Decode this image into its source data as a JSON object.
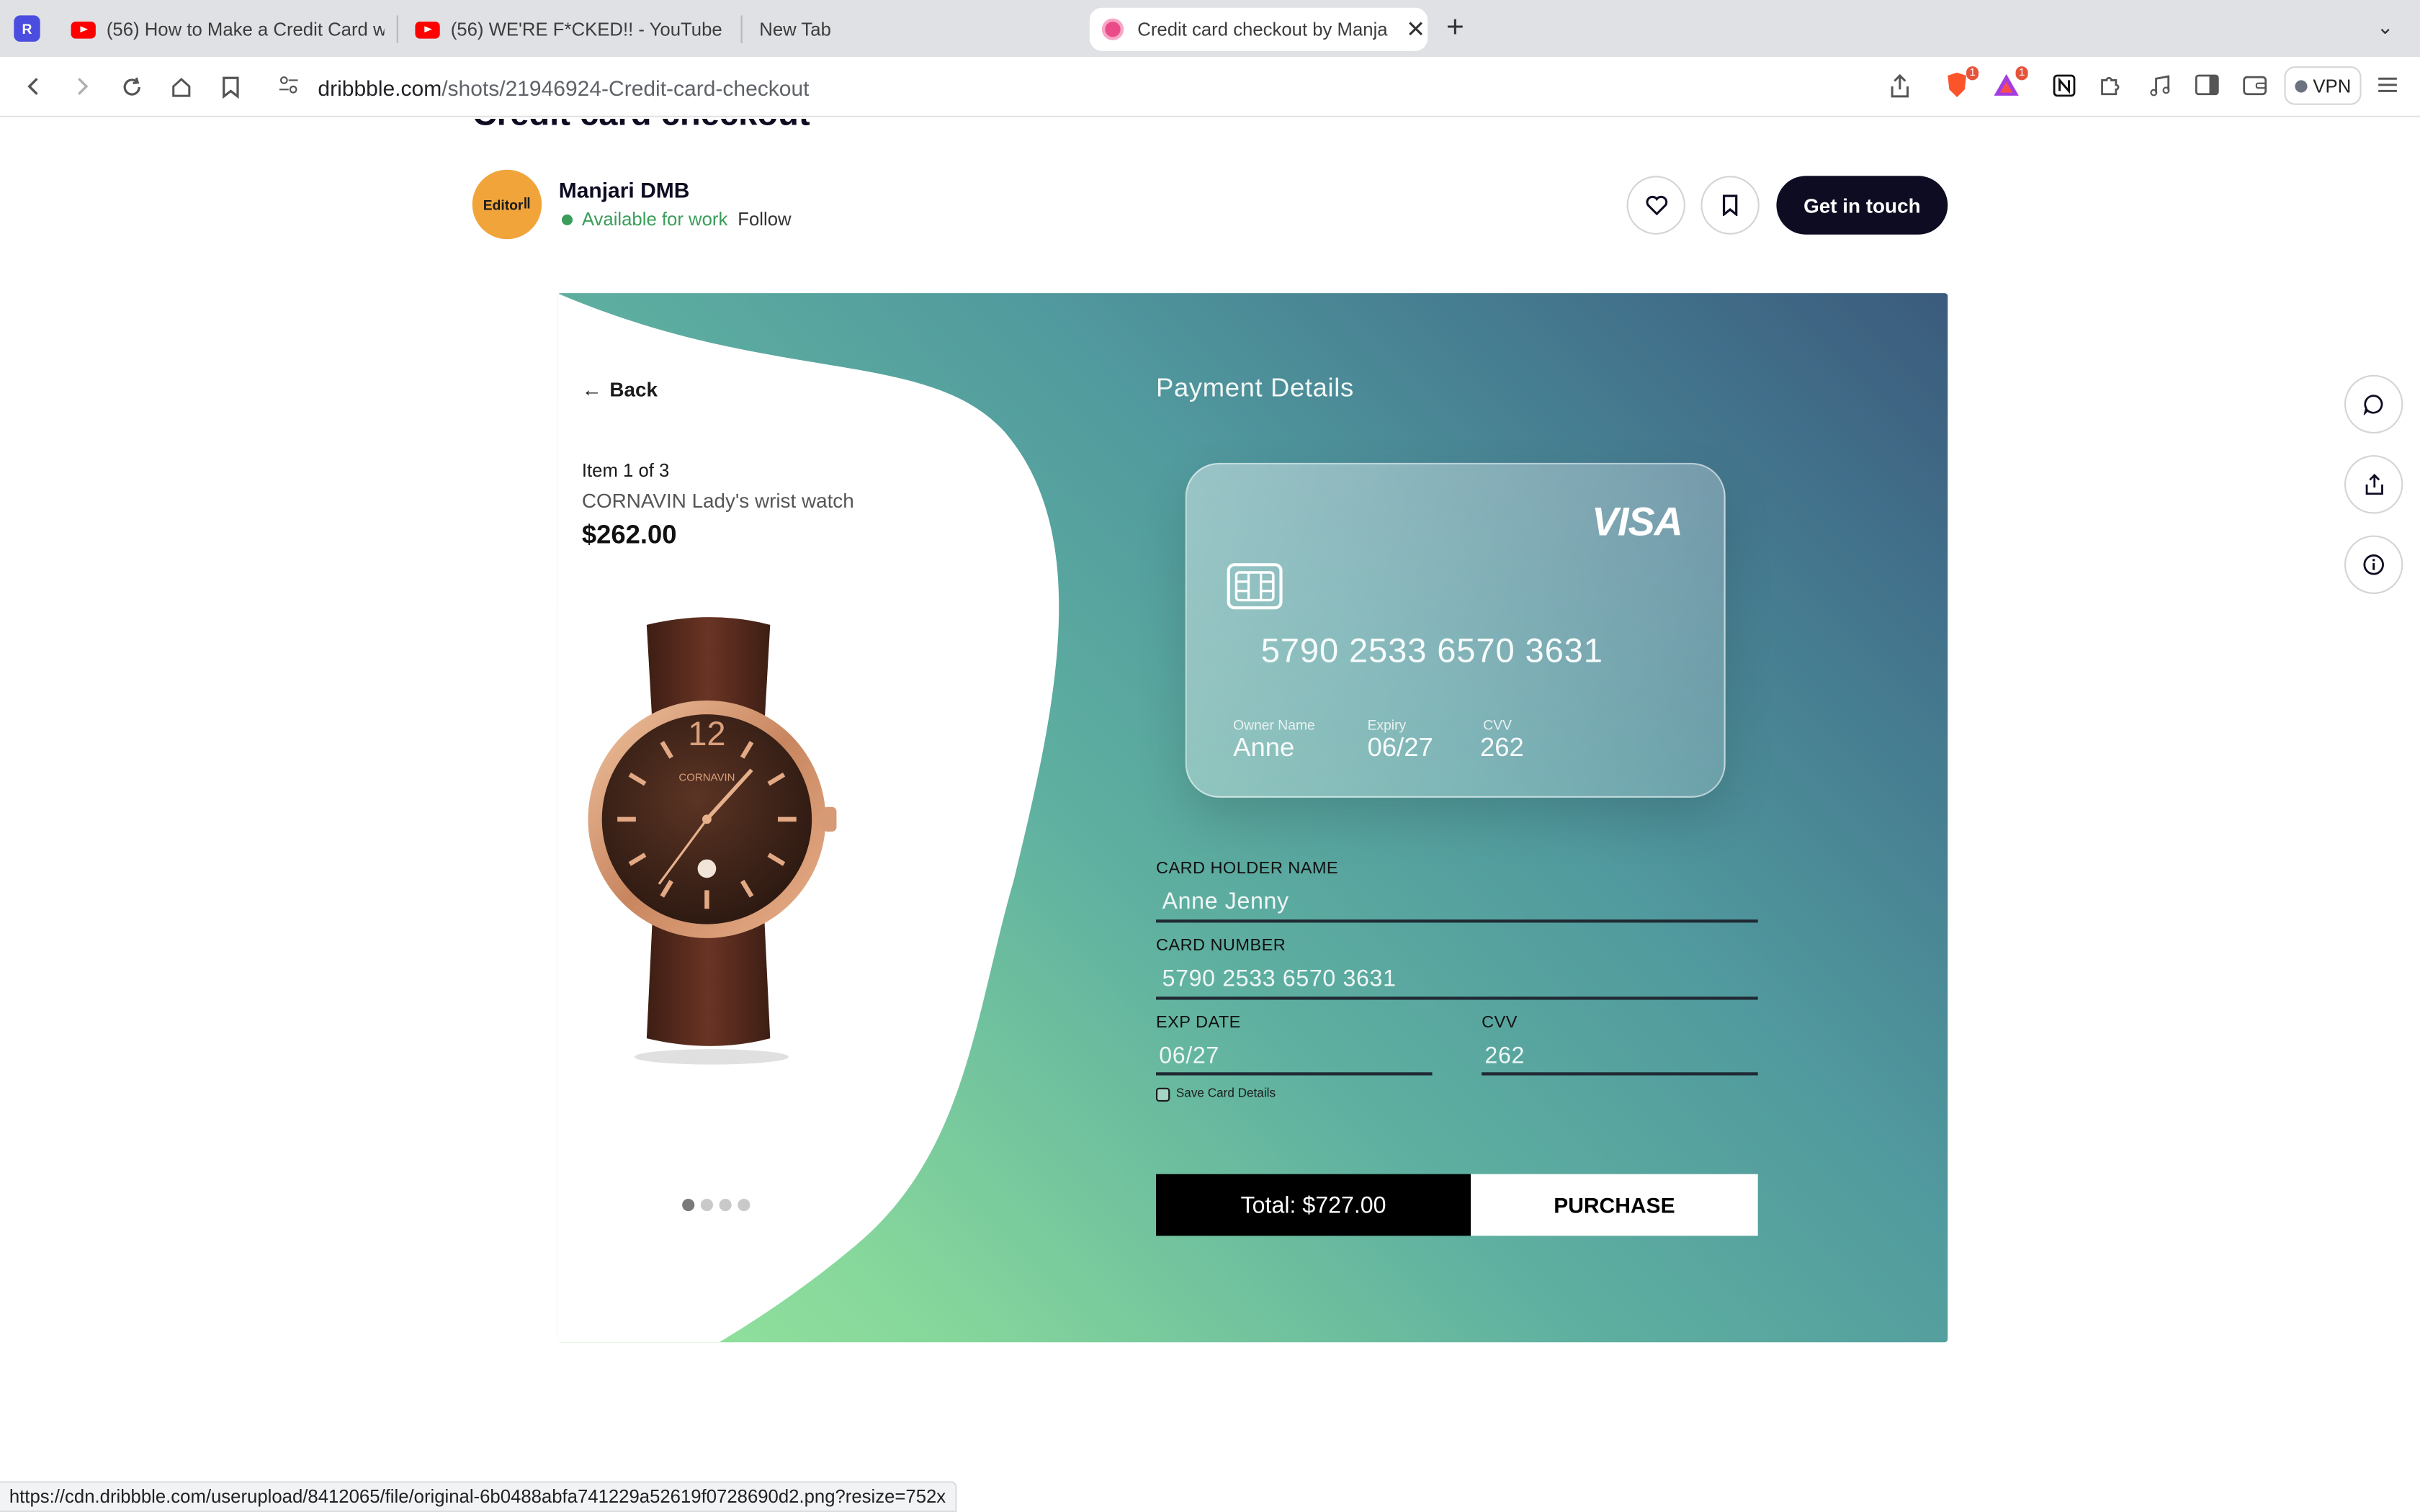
{
  "browser": {
    "app_icon_letter": "R",
    "tabs": [
      {
        "title": "(56) How to Make a Credit Card w",
        "icon": "youtube-icon"
      },
      {
        "title": "(56) WE'RE F*CKED!! - YouTube",
        "icon": "youtube-icon"
      },
      {
        "title": "New Tab",
        "icon": ""
      },
      {
        "title": "Credit card checkout by Manja",
        "icon": "dribbble-icon",
        "active": true
      }
    ],
    "url_host": "dribbble.com",
    "url_path": "/shots/21946924-Credit-card-checkout",
    "brave_badge": "1",
    "rewards_badge": "1",
    "vpn_label": "VPN",
    "status_url": "https://cdn.dribbble.com/userupload/8412065/file/original-6b0488abfa741229a52619f0728690d2.png?resize=752x"
  },
  "shot": {
    "title": "Credit card checkout",
    "author": "Manjari DMB",
    "avatar_text": "Editor",
    "availability": "Available for work",
    "follow_label": "Follow",
    "get_in_touch_label": "Get in touch"
  },
  "checkout": {
    "back_label": "Back",
    "item_count": "Item 1 of 3",
    "item_name": "CORNAVIN Lady's wrist watch",
    "item_price": "$262.00",
    "watch_brand": "CORNAVIN",
    "carousel_total": 4,
    "carousel_active": 1,
    "payment_title": "Payment Details",
    "card": {
      "brand": "VISA",
      "number": "5790 2533 6570 3631",
      "owner_label": "Owner Name",
      "owner_value": "Anne",
      "expiry_label": "Expiry",
      "expiry_value": "06/27",
      "cvv_label": "CVV",
      "cvv_value": "262"
    },
    "form": {
      "holder_label": "CARD HOLDER NAME",
      "holder_value": "Anne Jenny",
      "number_label": "CARD NUMBER",
      "number_value": "5790 2533 6570 3631",
      "exp_label": "EXP DATE",
      "exp_value": "06/27",
      "cvv_label": "CVV",
      "cvv_value": "262",
      "save_label": "Save Card Details"
    },
    "total_label": "Total: $727.00",
    "purchase_label": "PURCHASE"
  },
  "colors": {
    "gradient_light": "#95e49d",
    "gradient_mid": "#5fb0a0",
    "gradient_dark": "#3b5b7c",
    "dribbble_dark": "#0d0c22",
    "available_green": "#3a9d5a"
  }
}
